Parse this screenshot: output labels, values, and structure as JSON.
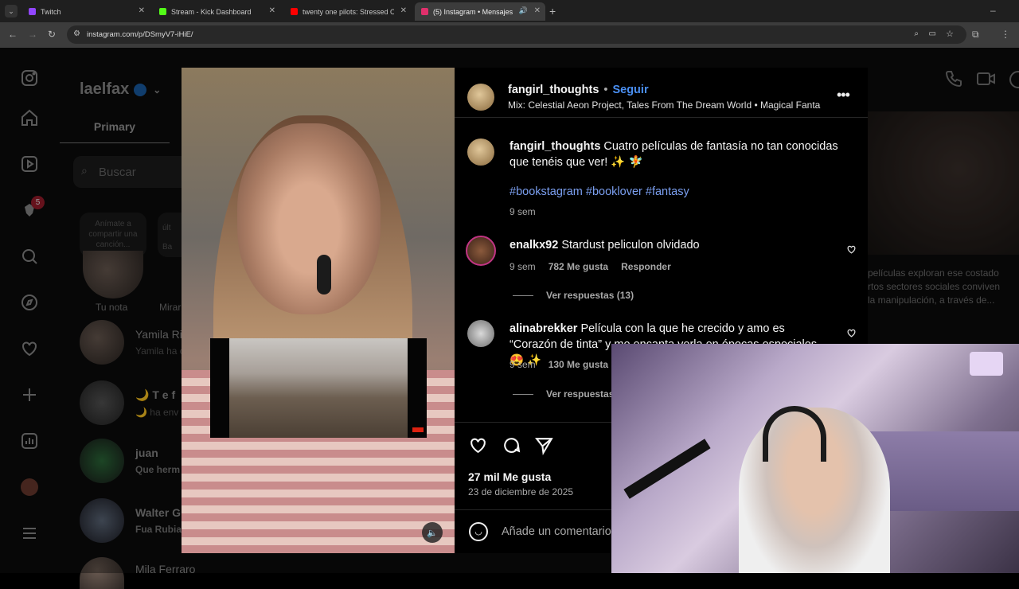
{
  "browser": {
    "tabs": [
      {
        "label": "Twitch",
        "color": "#9146ff"
      },
      {
        "label": "Stream - Kick Dashboard",
        "color": "#53fc18"
      },
      {
        "label": "twenty one pilots: Stressed Out",
        "color": "#ff0000"
      },
      {
        "label": "(5) Instagram • Mensajes",
        "color": "#e1306c"
      }
    ],
    "url": "instagram.com/p/DSmyV7-iHiE/"
  },
  "sidebar": {
    "notification_badge": "5"
  },
  "inbox": {
    "username": "laelfax",
    "primary_tab": "Primary",
    "search_placeholder": "Buscar",
    "note_bubble": "Anímate a compartir una canción...",
    "note_bubble2_top": "últ",
    "note_bubble2_bot": "Ba",
    "your_note": "Tu nota",
    "note2": "Mirar",
    "threads": [
      {
        "name": "Yamila Ri",
        "preview": "Yamila ha c"
      },
      {
        "name": "🌙 T e f",
        "preview": "🌙 ha env"
      },
      {
        "name": "juan",
        "preview": "Que herm"
      },
      {
        "name": "Walter G",
        "preview": "Fua Rubia"
      },
      {
        "name": "Mila Ferraro",
        "preview": ""
      }
    ],
    "background_text": "películas exploran ese costado\nrtos sectores sociales conviven\nla manipulación, a través de..."
  },
  "post": {
    "author": "fangirl_thoughts",
    "follow": "Seguir",
    "audio": "Mix: Celestial Aeon Project, Tales From The Dream World • Magical Fanta",
    "caption_user": "fangirl_thoughts",
    "caption_text": "Cuatro películas de fantasía no tan conocidas que tenéis que ver! ✨ 🧚",
    "hashtags": "#bookstagram #booklover #fantasy",
    "caption_time": "9 sem",
    "comments": [
      {
        "user": "enalkx92",
        "text": "Stardust peliculon olvidado",
        "time": "9 sem",
        "likes": "782 Me gusta",
        "reply": "Responder",
        "view_replies": "Ver respuestas (13)"
      },
      {
        "user": "alinabrekker",
        "text": "Película con la que he crecido y amo es “Corazón de tinta” y me encanta verla en épocas especiales 😍 ✨",
        "time": "9 sem",
        "likes": "130 Me gusta",
        "reply": "",
        "view_replies": "Ver respuestas"
      }
    ],
    "likes": "27 mil Me gusta",
    "date": "23 de diciembre de 2025",
    "add_comment": "Añade un comentario"
  }
}
